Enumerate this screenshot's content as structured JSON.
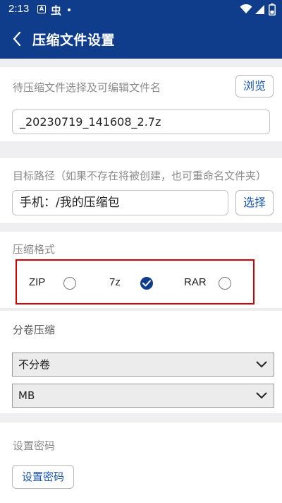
{
  "status_bar": {
    "time": "2:13",
    "app_glyph": "虫"
  },
  "header": {
    "title": "压缩文件设置"
  },
  "filename_section": {
    "label": "待压缩文件选择及可编辑文件名",
    "browse_button": "浏览",
    "filename_value": "_20230719_141608_2.7z"
  },
  "target_section": {
    "label": "目标路径（如果不存在将被创建，也可重命名文件夹）",
    "path_value": "手机：/我的压缩包",
    "choose_button": "选择"
  },
  "format_section": {
    "label": "压缩格式",
    "options": [
      {
        "label": "ZIP",
        "checked": false
      },
      {
        "label": "7z",
        "checked": true
      },
      {
        "label": "RAR",
        "checked": false
      }
    ],
    "selected": "7z",
    "highlight_color": "#d40000"
  },
  "split_section": {
    "label": "分卷压缩",
    "split_mode_selected": "不分卷",
    "unit_selected": "MB"
  },
  "password_section": {
    "label": "设置密码",
    "button": "设置密码"
  },
  "colors": {
    "primary": "#0f3d8c",
    "accent_text": "#1a56b0",
    "background": "#efeff2"
  }
}
